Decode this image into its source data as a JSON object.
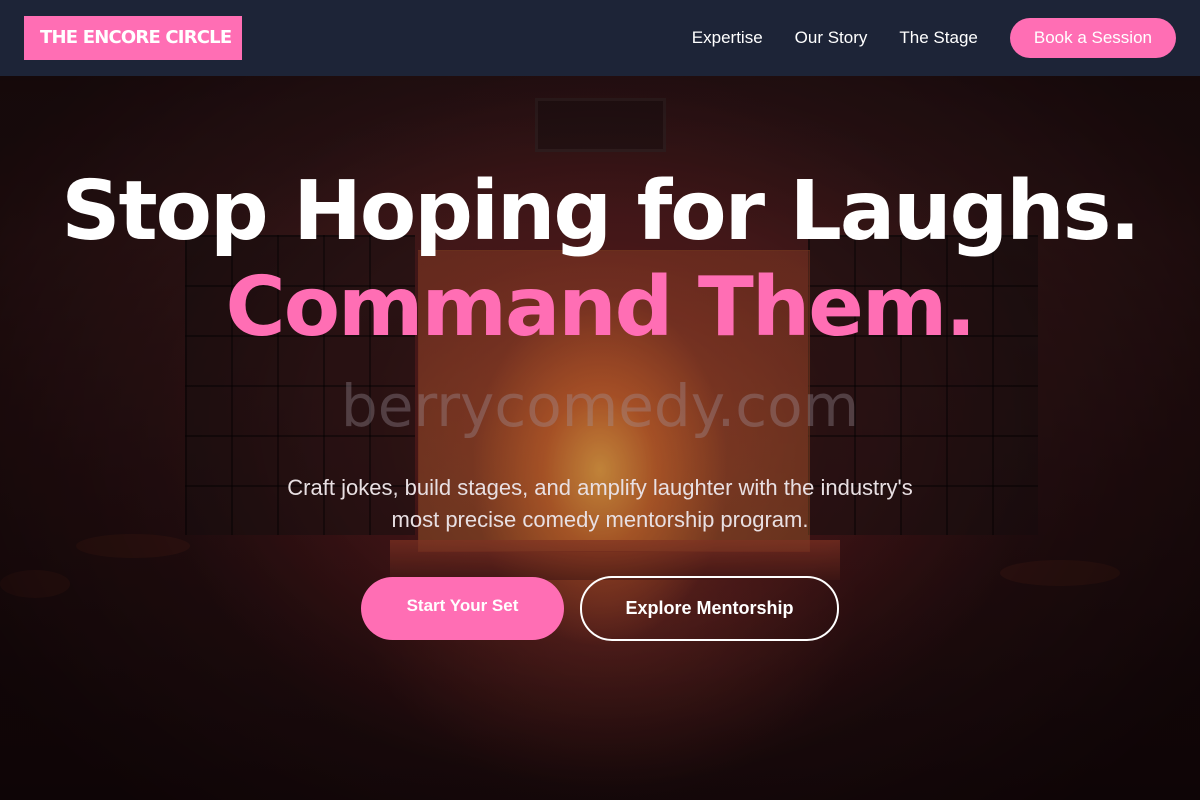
{
  "brand": {
    "logo_text": "THE ENCORE CIRCLE",
    "accent_color": "#ff6eb4",
    "header_color": "#1e263a"
  },
  "nav": {
    "items": [
      {
        "label": "Expertise"
      },
      {
        "label": "Our Story"
      },
      {
        "label": "The Stage"
      }
    ],
    "cta_label": "Book a Session"
  },
  "hero": {
    "headline_part1": "Stop Hoping for Laughs.",
    "headline_accent": "Command Them.",
    "subtitle": "Craft jokes, build stages, and amplify laughter with the industry's most precise comedy mentorship program.",
    "primary_cta": "Start Your Set",
    "secondary_cta": "Explore Mentorship",
    "watermark": "berrycomedy.com"
  }
}
